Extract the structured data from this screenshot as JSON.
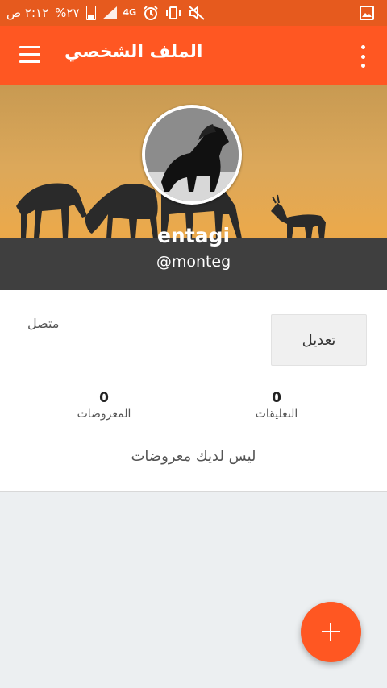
{
  "status_bar": {
    "time": "٢:١٢ ص",
    "battery": "%٢٧",
    "network": "4G",
    "icons": [
      "gallery-icon",
      "mute-icon",
      "vibrate-icon",
      "alarm-icon",
      "signal-icon",
      "battery-icon"
    ]
  },
  "app_bar": {
    "title": "الملف الشخصي",
    "menu_icon": "menu-icon",
    "more_icon": "more-vert-icon"
  },
  "profile": {
    "display_name": "entagi",
    "handle": "@monteg",
    "status": "متصل",
    "edit_label": "تعديل"
  },
  "stats": {
    "posts": {
      "count": "0",
      "label": "المعروضات"
    },
    "comments": {
      "count": "0",
      "label": "التعليقات"
    }
  },
  "empty_message": "ليس لديك معروضات",
  "fab": {
    "icon": "plus-icon"
  },
  "colors": {
    "accent": "#ff5722",
    "status_bar": "#e65a1e",
    "cover_ground": "#3f3f3f",
    "background": "#eceff1"
  }
}
